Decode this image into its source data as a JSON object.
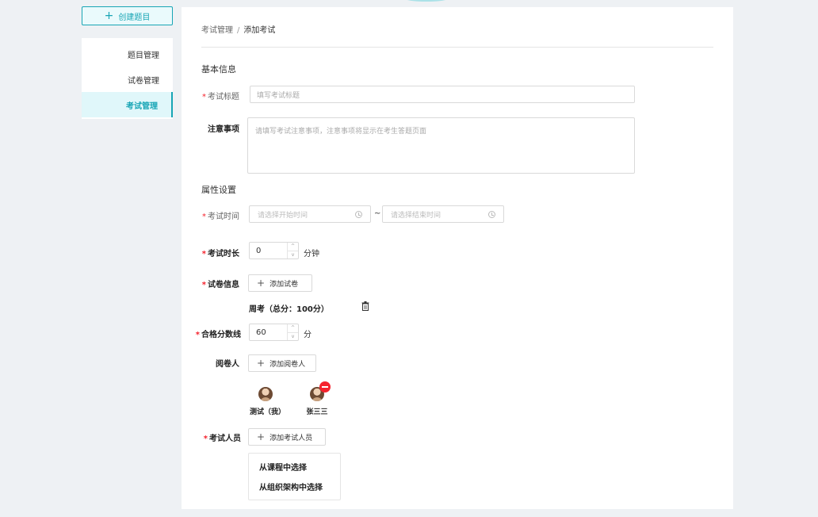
{
  "create_button": {
    "icon": "plus-icon",
    "label": "创建题目"
  },
  "sidebar": {
    "items": [
      {
        "label": "题目管理",
        "active": false
      },
      {
        "label": "试卷管理",
        "active": false
      },
      {
        "label": "考试管理",
        "active": true
      }
    ]
  },
  "breadcrumb": {
    "parent": "考试管理",
    "separator": "/",
    "current": "添加考试"
  },
  "basic_info": {
    "title": "基本信息",
    "exam_title": {
      "required_mark": "*",
      "label": "考试标题",
      "placeholder": "填写考试标题"
    },
    "notes": {
      "label": "注意事项",
      "placeholder": "请填写考试注意事项，注意事项将显示在考生答题页面"
    }
  },
  "attributes": {
    "title": "属性设置",
    "exam_time": {
      "required_mark": "*",
      "label": "考试时间",
      "start_placeholder": "请选择开始时间",
      "end_placeholder": "请选择结束时间",
      "range_separator": "~",
      "icon": "clock-icon"
    },
    "duration": {
      "required_mark": "*",
      "label": "考试时长",
      "value": "0",
      "unit": "分钟",
      "up": "^",
      "down": "v"
    },
    "paper": {
      "required_mark": "*",
      "label": "试卷信息",
      "add_label": "添加试卷",
      "paper_name": "周考（总分：100分）",
      "delete_icon": "trash-icon"
    },
    "pass_score": {
      "required_mark": "*",
      "label": "合格分数线",
      "value": "60",
      "unit": "分",
      "up": "^",
      "down": "v"
    },
    "graders": {
      "label": "阅卷人",
      "add_label": "添加阅卷人",
      "people": [
        {
          "name": "测试（我）",
          "removable": false
        },
        {
          "name": "张三三",
          "removable": true
        }
      ]
    },
    "examinees": {
      "required_mark": "*",
      "label": "考试人员",
      "add_label": "添加考试人员",
      "options": [
        "从课程中选择",
        "从组织架构中选择"
      ]
    }
  },
  "colors": {
    "accent": "#18a5b5",
    "required": "#f5222d",
    "background": "#eef1f4"
  }
}
